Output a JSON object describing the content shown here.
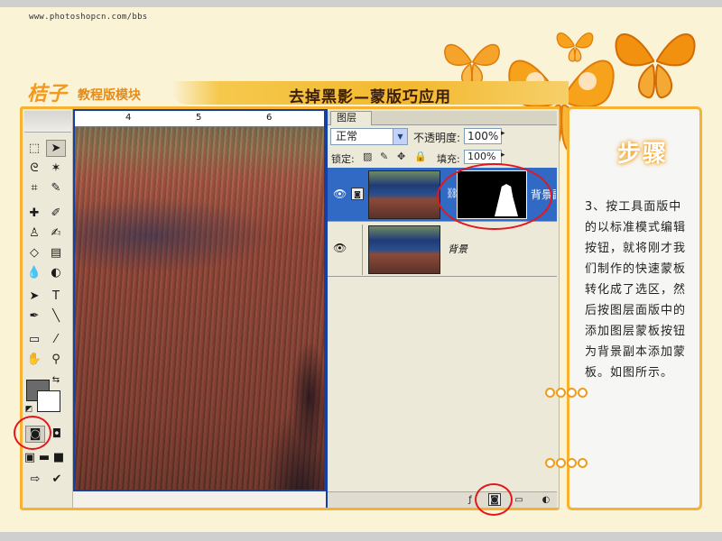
{
  "site": {
    "url": "www.photoshopcn.com/bbs"
  },
  "brand": {
    "title": "桔子",
    "subtitle": "教程版模块"
  },
  "lesson": {
    "title": "去掉黑影—蒙版巧应用"
  },
  "ruler": {
    "ticks": [
      "4",
      "5",
      "6"
    ]
  },
  "layers_panel": {
    "tab_label": "图层",
    "blend_mode": "正常",
    "opacity_label": "不透明度:",
    "opacity_value": "100%",
    "lock_label": "锁定:",
    "fill_label": "填充:",
    "fill_value": "100%",
    "layers": [
      {
        "name": "背景副",
        "selected": true,
        "has_mask": true
      },
      {
        "name": "背景",
        "selected": false,
        "has_mask": false
      }
    ]
  },
  "steps": {
    "header": "步骤",
    "text": "3、按工具面版中的以标准模式编辑按钮，就将刚才我们制作的快速蒙板转化成了选区，然后按图层面版中的添加图层蒙板按钮为背景副本添加蒙板。如图所示。"
  },
  "colors": {
    "accent_orange": "#f7b232",
    "selection_blue": "#316ac5",
    "annotation_red": "#e4161c",
    "foreground_swatch": "#6a6a6a",
    "background_swatch": "#ffffff"
  }
}
